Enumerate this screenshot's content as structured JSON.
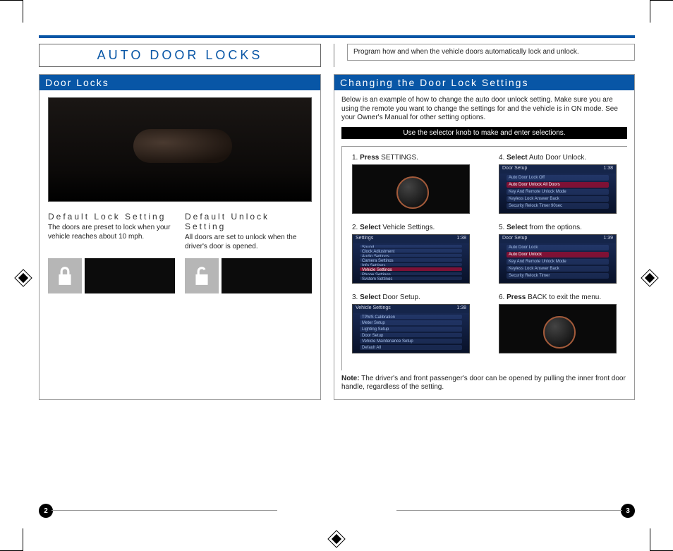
{
  "title": "AUTO DOOR LOCKS",
  "intro": "Program how and when the vehicle doors automatically lock and unlock.",
  "left": {
    "header": "Door Locks",
    "sub": [
      {
        "head": "Default Lock Setting",
        "text": "The doors are preset to lock when your vehicle reaches about 10 mph."
      },
      {
        "head": "Default Unlock Setting",
        "text": "All doors are set to unlock when the driver's door is opened."
      }
    ]
  },
  "right": {
    "header": "Changing the Door Lock Settings",
    "desc": "Below is an example of how to change the auto door unlock setting. Make sure you are using the remote you want to change the settings for and the vehicle is in ON mode. See your Owner's Manual for other setting options.",
    "bar": "Use the selector knob to make and enter selections.",
    "steps_left": [
      {
        "n": "1.",
        "b": "Press",
        "rest": " SETTINGS."
      },
      {
        "n": "2.",
        "b": "Select",
        "rest": " Vehicle Settings."
      },
      {
        "n": "3.",
        "b": "Select",
        "rest": " Door Setup."
      }
    ],
    "steps_right": [
      {
        "n": "4.",
        "b": "Select",
        "rest": " Auto Door Unlock."
      },
      {
        "n": "5.",
        "b": "Select",
        "rest": " from the options."
      },
      {
        "n": "6.",
        "b": "Press",
        "rest": " BACK to exit the menu."
      }
    ],
    "screens": {
      "s2": {
        "title": "Settings",
        "time": "1:38",
        "rows": [
          "Sound",
          "Clock Adjustment",
          "Audio Settings",
          "Camera Settings",
          "Info Settings",
          "Vehicle Settings",
          "Phone Settings",
          "System Settings"
        ],
        "sel": 5
      },
      "s3": {
        "title": "Vehicle Settings",
        "time": "1:38",
        "rows": [
          "TPMS Calibration",
          "Meter Setup",
          "Lighting Setup",
          "Door Setup",
          "Vehicle Maintenance Setup",
          "Default All"
        ],
        "sel": -1
      },
      "s4": {
        "title": "Door Setup",
        "time": "1:38",
        "rows": [
          "Auto Door Lock            Off",
          "Auto Door Unlock      All Doors",
          "Key And Remote Unlock Mode",
          "Keyless Lock Answer Back",
          "Security Relock Timer      90sec"
        ],
        "sel": 1
      },
      "s5": {
        "title": "Door Setup",
        "time": "1:39",
        "rows": [
          "Auto Door Lock",
          "Auto Door Unlock",
          "Key And Remote Unlock Mode",
          "Keyless Lock Answer Back",
          "Security Relock Timer"
        ],
        "sel": 1
      }
    },
    "note_b": "Note:",
    "note": " The driver's and front passenger's door can be opened by pulling the inner front door handle, regardless of the setting."
  },
  "page_left": "2",
  "page_right": "3"
}
